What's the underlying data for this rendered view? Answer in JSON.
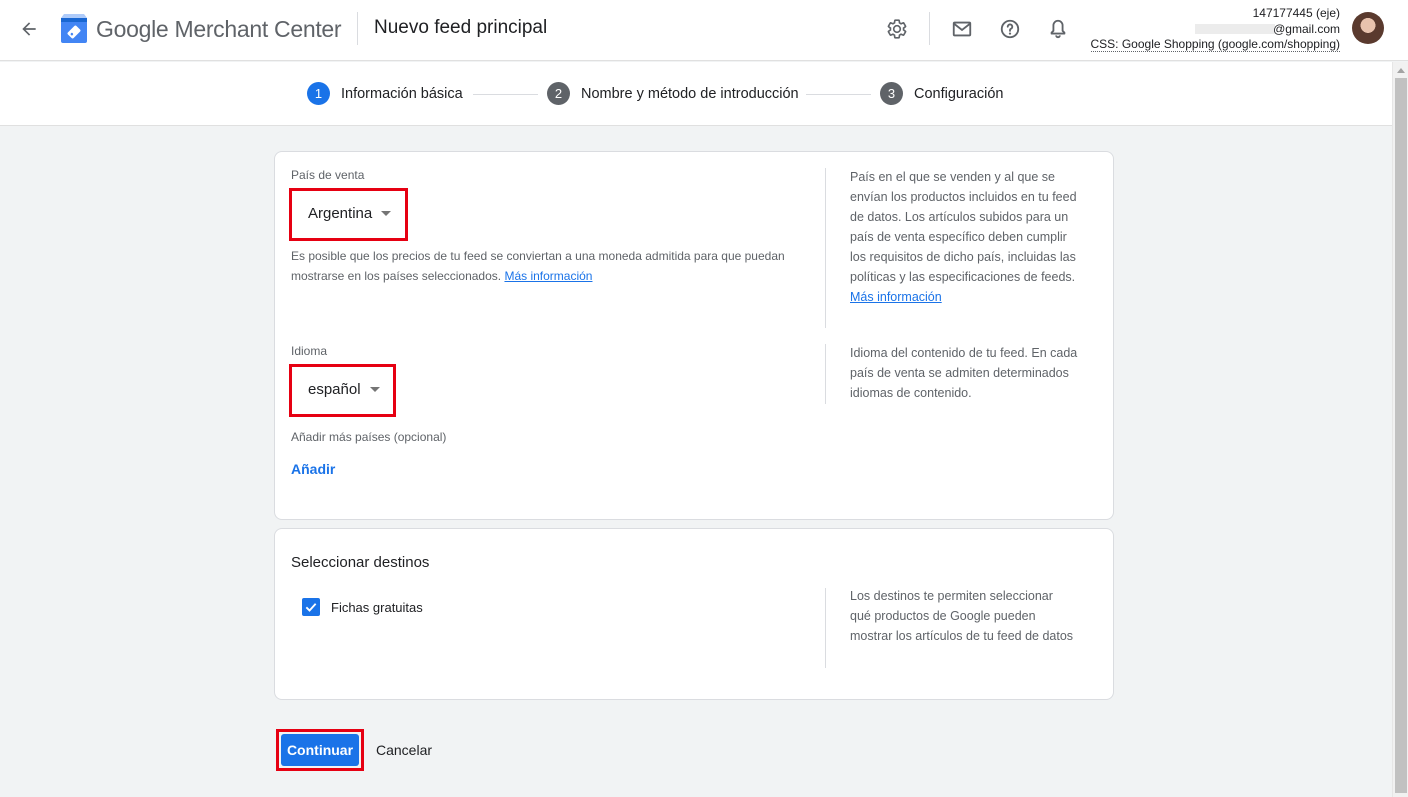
{
  "header": {
    "brand_google": "Google",
    "brand_product": "Merchant Center",
    "page_title": "Nuevo feed principal",
    "icons": [
      "arrow-back-icon",
      "merchant-center-logo",
      "gear-icon",
      "mail-icon",
      "help-icon",
      "bell-icon"
    ],
    "account": {
      "id": "147177445 (eje)",
      "email_suffix": "@gmail.com",
      "css": "CSS: Google Shopping (google.com/shopping)"
    }
  },
  "stepper": {
    "steps": [
      {
        "num": "1",
        "label": "Información básica",
        "active": true
      },
      {
        "num": "2",
        "label": "Nombre y método de introducción",
        "active": false
      },
      {
        "num": "3",
        "label": "Configuración",
        "active": false
      }
    ]
  },
  "basic_info": {
    "country": {
      "label": "País de venta",
      "value": "Argentina",
      "helper": "Es posible que los precios de tu feed se conviertan a una moneda admitida para que puedan mostrarse en los países seleccionados.",
      "helper_link": "Más información",
      "side_text": "País en el que se venden y al que se envían los productos incluidos en tu feed de datos. Los artículos subidos para un país de venta específico deben cumplir los requisitos de dicho país, incluidas las políticas y las especificaciones de feeds.",
      "side_link": "Más información"
    },
    "language": {
      "label": "Idioma",
      "value": "español",
      "side_text": "Idioma del contenido de tu feed. En cada país de venta se admiten determinados idiomas de contenido."
    },
    "more_countries_label": "Añadir más países (opcional)",
    "add_button": "Añadir"
  },
  "destinations": {
    "title": "Seleccionar destinos",
    "checkbox_label": "Fichas gratuitas",
    "checked": true,
    "side_text": "Los destinos te permiten seleccionar qué productos de Google pueden mostrar los artículos de tu feed de datos"
  },
  "actions": {
    "continue_label": "Continuar",
    "cancel_label": "Cancelar"
  },
  "colors": {
    "primary": "#1a73e8",
    "highlight": "#e60012",
    "step_inactive": "#5f6368"
  }
}
